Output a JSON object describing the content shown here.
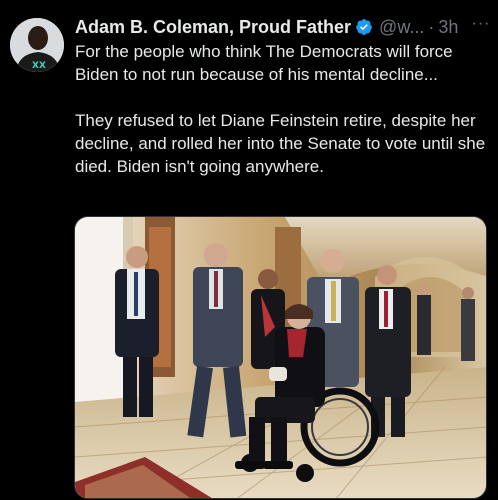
{
  "tweet": {
    "display_name": "Adam B. Coleman, Proud Father",
    "handle": "@w...",
    "separator": "·",
    "time": "3h",
    "more_label": "···",
    "text": "For the people who think The Democrats will force Biden to not run because of his mental decline...\n\nThey refused to let Diane Feinstein retire, despite her decline, and rolled her into the Senate to vote until she died. Biden isn't going anywhere.",
    "avatar_icon": "avatar-person-icon",
    "verified_icon": "verified-badge-icon",
    "media": {
      "description_icon": "photo-senate-hallway-wheelchair"
    }
  },
  "colors": {
    "background": "#000000",
    "text": "#e7e9ea",
    "muted": "#71767b",
    "verified": "#1d9bf0"
  }
}
